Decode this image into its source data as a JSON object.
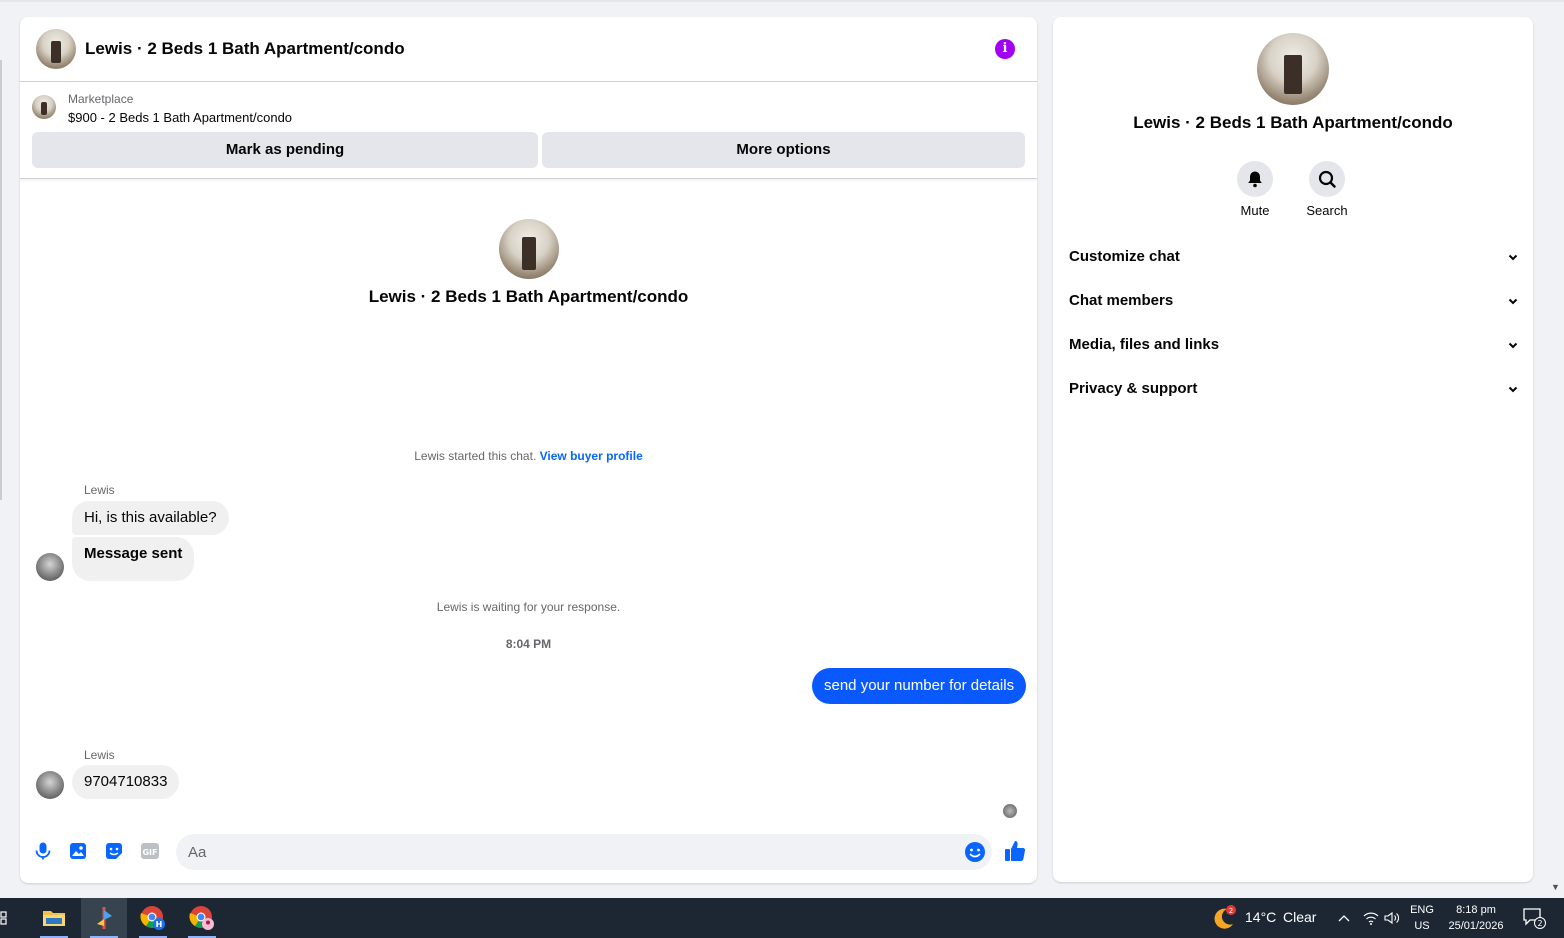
{
  "chat": {
    "title": "Lewis · 2 Beds 1 Bath Apartment/condo",
    "info_icon": "info-icon",
    "listing": {
      "source": "Marketplace",
      "price_title": "$900 - 2 Beds 1 Bath Apartment/condo",
      "mark_pending_label": "Mark as pending",
      "more_options_label": "More options"
    },
    "intro_title": "Lewis · 2 Beds 1 Bath Apartment/condo",
    "started_text": "Lewis started this chat.",
    "view_profile_link": "View buyer profile",
    "messages": [
      {
        "sender": "Lewis",
        "text": "Hi, is this available?"
      },
      {
        "text": "Message sent"
      }
    ],
    "waiting_text": "Lewis is waiting for your response.",
    "timestamp": "8:04 PM",
    "outgoing": "send your number for details",
    "second_sender": "Lewis",
    "reply": "9704710833",
    "composer": {
      "placeholder": "Aa",
      "icons": [
        "mic-icon",
        "photo-icon",
        "sticker-icon",
        "gif-icon",
        "emoji-icon",
        "like-icon"
      ],
      "gif_label": "GIF"
    },
    "colors": {
      "accent": "#0a59ff",
      "info": "#a100f2"
    }
  },
  "info_panel": {
    "title": "Lewis · 2 Beds 1 Bath Apartment/condo",
    "actions": [
      {
        "label": "Mute",
        "icon": "bell-icon"
      },
      {
        "label": "Search",
        "icon": "search-icon"
      }
    ],
    "sections": [
      "Customize chat",
      "Chat members",
      "Media, files and links",
      "Privacy & support"
    ]
  },
  "taskbar": {
    "weather_badge": "2",
    "temperature": "14°C",
    "condition": "Clear",
    "lang_top": "ENG",
    "lang_bottom": "US",
    "time": "8:18 pm",
    "date": "25/01/2026",
    "notification_count": "2",
    "chrome_profile_letter": "H"
  }
}
